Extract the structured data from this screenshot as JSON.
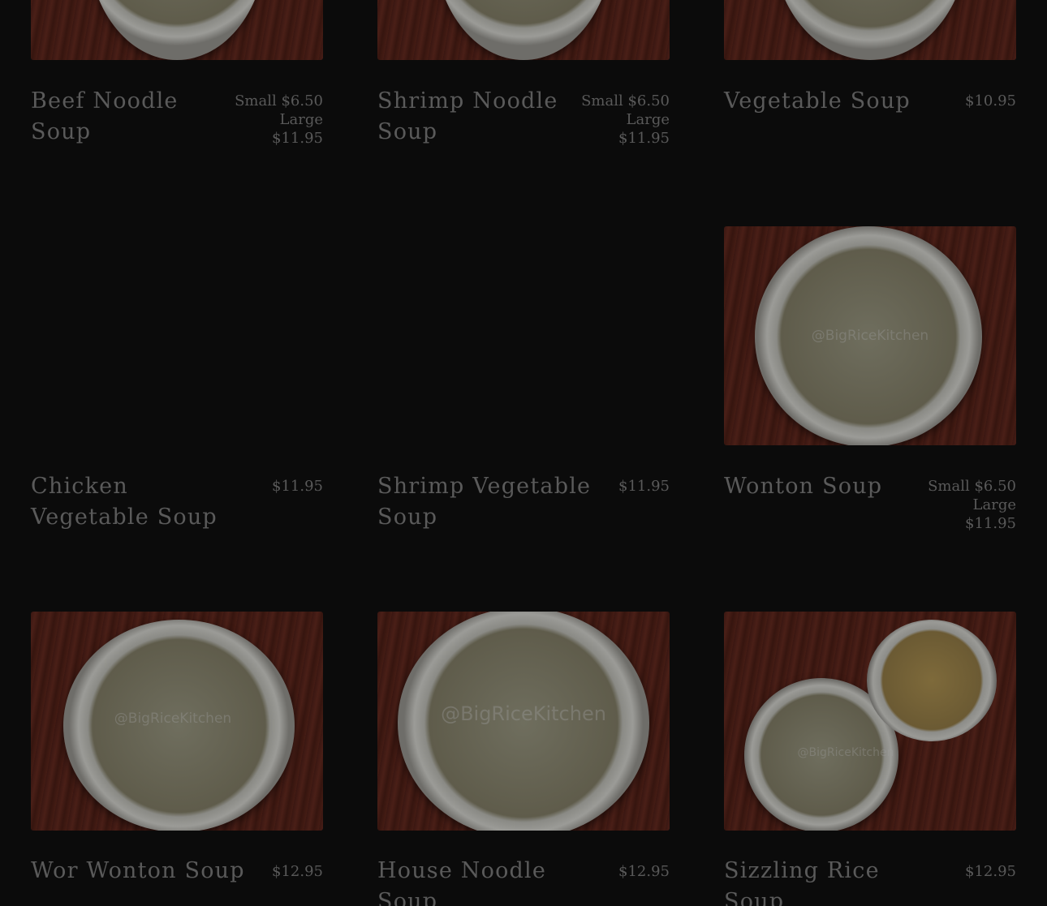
{
  "menu": {
    "items": [
      {
        "name": "Beef Noodle Soup",
        "prices": [
          "Small $6.50",
          "Large",
          "$11.95"
        ]
      },
      {
        "name": "Shrimp Noodle Soup",
        "prices": [
          "Small $6.50",
          "Large",
          "$11.95"
        ]
      },
      {
        "name": "Vegetable Soup",
        "prices": [
          "$10.95"
        ]
      },
      {
        "name": "Chicken Vegetable Soup",
        "prices": [
          "$11.95"
        ]
      },
      {
        "name": "Shrimp Vegetable Soup",
        "prices": [
          "$11.95"
        ]
      },
      {
        "name": "Wonton Soup",
        "prices": [
          "Small $6.50",
          "Large",
          "$11.95"
        ]
      },
      {
        "name": "Wor Wonton Soup",
        "prices": [
          "$12.95"
        ]
      },
      {
        "name": "House Noodle Soup",
        "prices": [
          "$12.95"
        ]
      },
      {
        "name": "Sizzling Rice Soup",
        "prices": [
          "$12.95"
        ]
      }
    ],
    "watermark": "@BigRiceKitchen"
  }
}
